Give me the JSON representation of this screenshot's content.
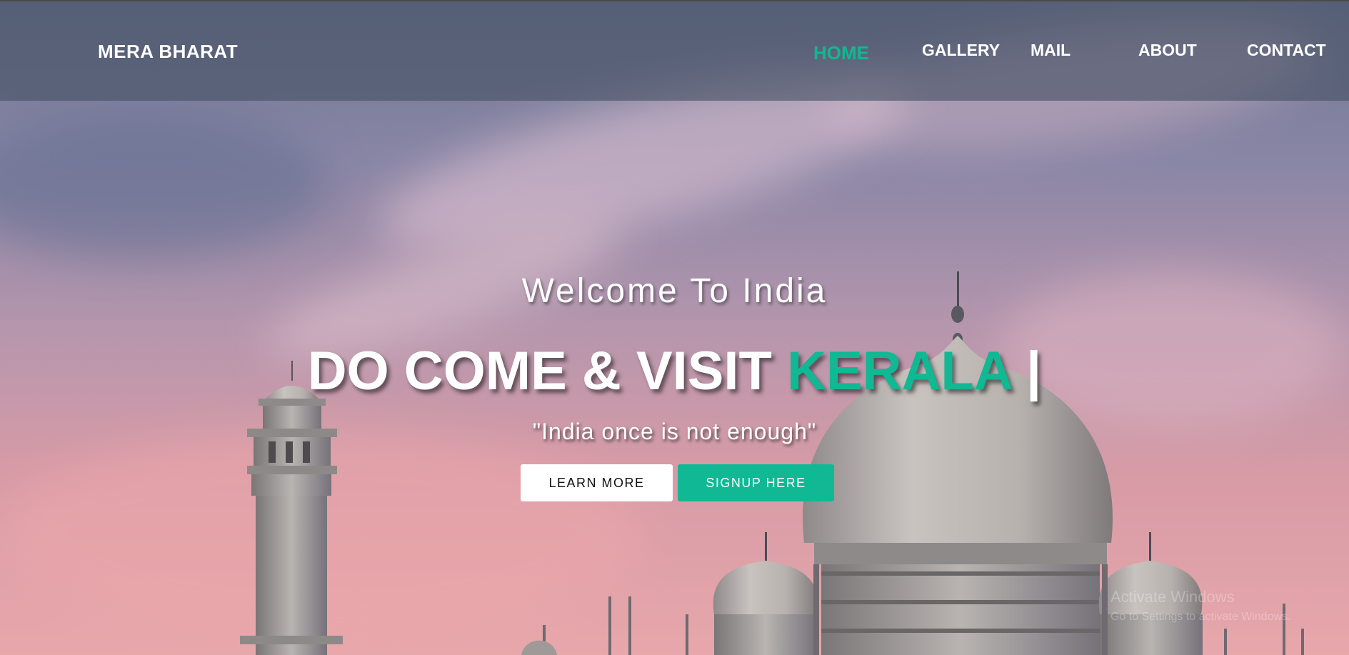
{
  "nav": {
    "brand": "MERA BHARAT",
    "items": [
      {
        "label": "HOME",
        "active": true
      },
      {
        "label": "GALLERY"
      },
      {
        "label": "MAIL"
      },
      {
        "label": "ABOUT"
      },
      {
        "label": "CONTACT"
      }
    ]
  },
  "hero": {
    "welcome": "Welcome To India",
    "headline_prefix": "DO COME & VISIT ",
    "headline_highlight": "KERALA",
    "headline_cursor": " |",
    "quote": "\"India once is not enough\"",
    "learn_more": "LEARN MORE",
    "signup": "SIGNUP HERE"
  },
  "os_watermark": {
    "line1": "Activate Windows",
    "line2": "Go to Settings to activate Windows."
  },
  "colors": {
    "accent": "#10b894",
    "navbar_bg": "rgba(70, 80, 100, 0.62)"
  }
}
